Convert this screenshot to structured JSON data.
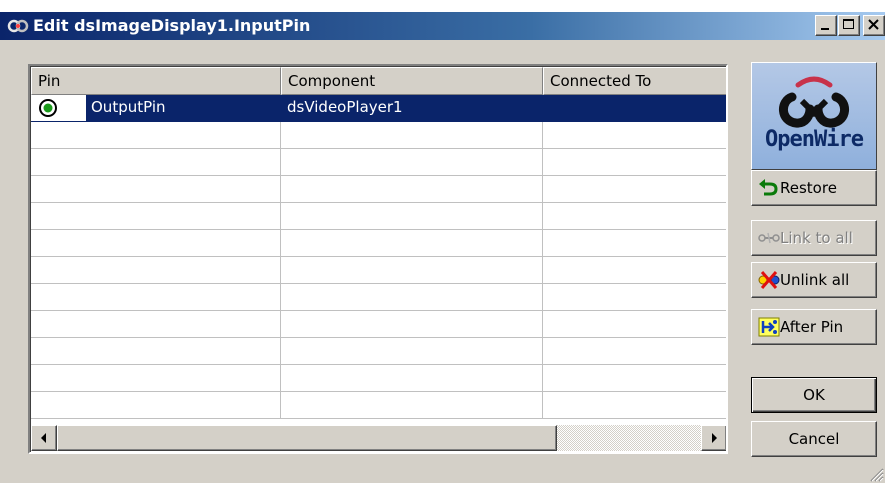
{
  "window": {
    "title": "Edit dsImageDisplay1.InputPin",
    "controls": [
      "minimize",
      "maximize",
      "close"
    ]
  },
  "grid": {
    "columns": [
      "Pin",
      "Component",
      "Connected To"
    ],
    "rows": [
      {
        "pin": "OutputPin",
        "component": "dsVideoPlayer1",
        "connected_to": "",
        "selected": true,
        "radio": "on"
      }
    ],
    "empty_rows": 11
  },
  "logo": {
    "text": "OpenWire"
  },
  "buttons": {
    "restore": "Restore",
    "link_to_all": "Link to all",
    "unlink_all": "Unlink all",
    "after_pin": "After Pin",
    "ok": "OK",
    "cancel": "Cancel"
  },
  "colors": {
    "titlebar_start": "#0a246a",
    "titlebar_end": "#a6caf0",
    "selection": "#0a246a",
    "face": "#d4d0c8"
  }
}
